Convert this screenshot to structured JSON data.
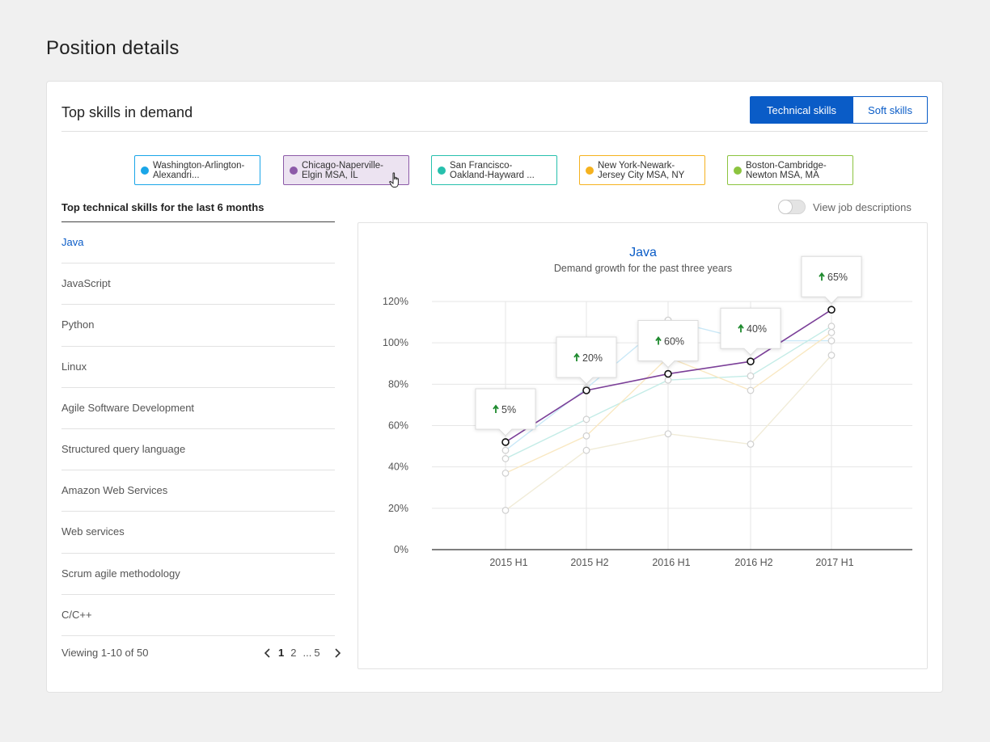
{
  "page": {
    "title": "Position details"
  },
  "card": {
    "title": "Top skills in demand",
    "toggle": {
      "technical_label": "Technical skills",
      "soft_label": "Soft skills"
    }
  },
  "regions": [
    {
      "label": "Washington-Arlington-\nAlexandri...",
      "color": "#1aa6e8",
      "selected": false
    },
    {
      "label": "Chicago-Naperville-\nElgin MSA, IL",
      "color": "#8c5aa8",
      "selected": true
    },
    {
      "label": "San Francisco-\nOakland-Hayward ...",
      "color": "#27c0ad",
      "selected": false
    },
    {
      "label": "New York-Newark-\nJersey City MSA, NY",
      "color": "#f5b21f",
      "selected": false
    },
    {
      "label": "Boston-Cambridge-\nNewton MSA, MA",
      "color": "#8cc43f",
      "selected": false
    }
  ],
  "skills": {
    "heading": "Top technical skills for the last 6 months",
    "items": [
      "Java",
      "JavaScript",
      "Python",
      "Linux",
      "Agile Software Development",
      "Structured query language",
      "Amazon Web Services",
      "Web services",
      "Scrum agile methodology",
      "C/C++"
    ],
    "viewing": "Viewing 1-10 of 50",
    "pages": {
      "first": "1",
      "second": "2",
      "ellipsis": "...",
      "last": "5"
    }
  },
  "job_toggle": {
    "label": "View job descriptions",
    "on": false
  },
  "chart_data": {
    "type": "line",
    "title": "Java",
    "subtitle": "Demand growth for the past three years",
    "categories": [
      "2015 H1",
      "2015 H2",
      "2016 H1",
      "2016 H2",
      "2017 H1"
    ],
    "yticks": [
      "0%",
      "20%",
      "40%",
      "60%",
      "80%",
      "100%",
      "120%"
    ],
    "ylim": [
      0,
      120
    ],
    "grid": true,
    "series": [
      {
        "region": "Chicago-Naperville-Elgin MSA, IL",
        "values": [
          52,
          77,
          85,
          91,
          116
        ],
        "color": "#7b3f98",
        "highlight": true
      },
      {
        "region": "Washington-Arlington-Alexandria",
        "values": [
          48,
          78,
          111,
          101,
          101
        ],
        "color": "#c9e8f7",
        "highlight": false
      },
      {
        "region": "San Francisco-Oakland-Hayward",
        "values": [
          44,
          63,
          82,
          84,
          108
        ],
        "color": "#c4ece7",
        "highlight": false
      },
      {
        "region": "New York-Newark-Jersey City MSA, NY",
        "values": [
          37,
          55,
          93,
          77,
          105
        ],
        "color": "#f9e8c2",
        "highlight": false
      },
      {
        "region": "Boston-Cambridge-Newton MSA, MA",
        "values": [
          19,
          48,
          56,
          51,
          94
        ],
        "color": "#f1ecd8",
        "highlight": false
      }
    ],
    "callouts": [
      "5%",
      "20%",
      "60%",
      "40%",
      "65%"
    ],
    "colors": {
      "title": "#0a5cc7",
      "growth_arrow": "#1e8a2e",
      "axis": "#333333",
      "grid": "#e6e6e6",
      "tick_label": "#555555"
    }
  }
}
